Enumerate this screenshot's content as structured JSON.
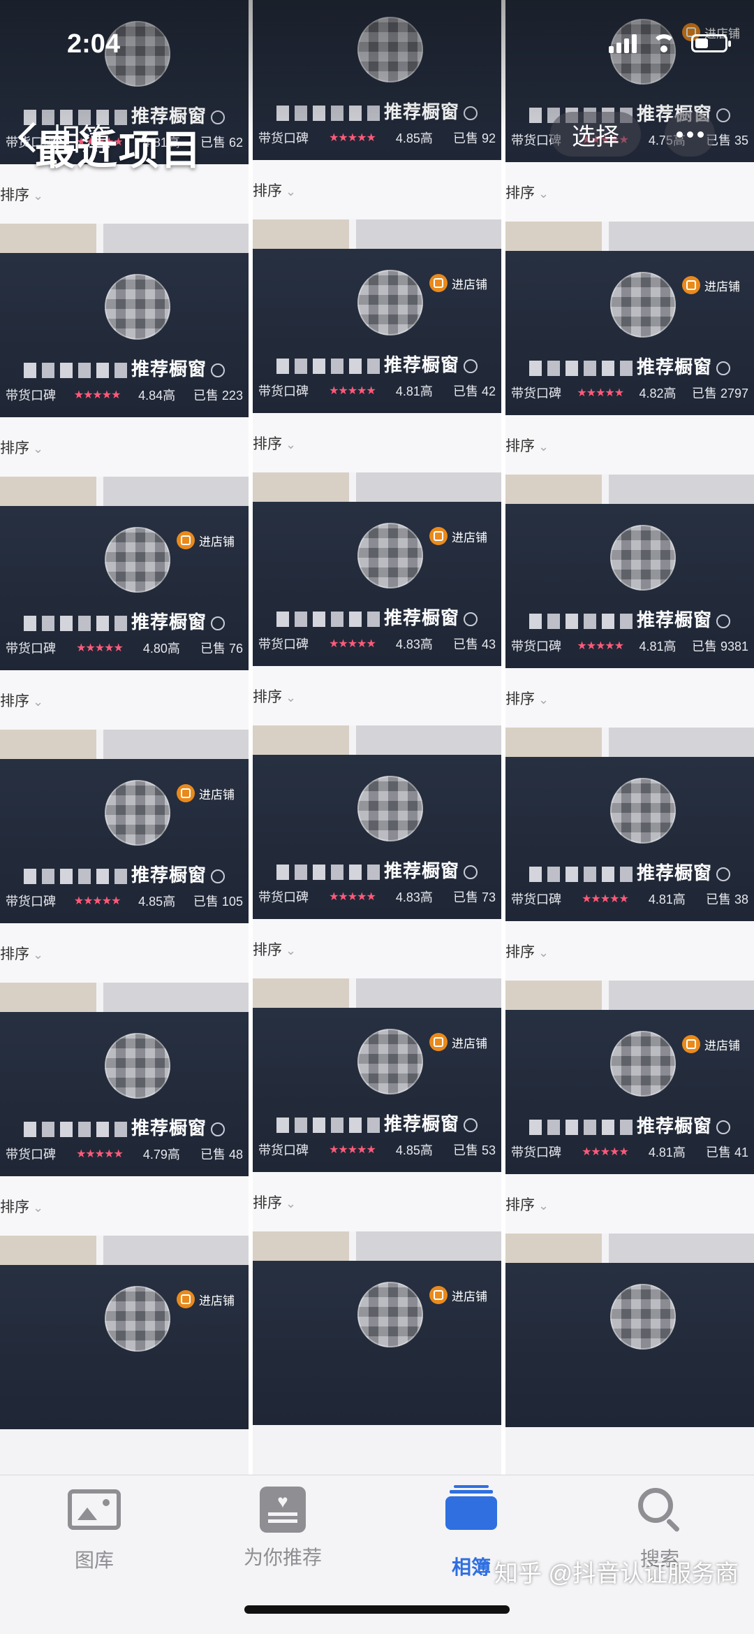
{
  "status_bar": {
    "time": "2:04"
  },
  "nav": {
    "back_label": "相簿",
    "select_label": "选择",
    "album_title": "最近项目"
  },
  "tile_labels": {
    "sort": "排序",
    "shop_badge": "进店铺",
    "title_suffix": "推荐橱窗",
    "rating_prefix": "带货口碑",
    "stars": "★★★★★"
  },
  "tiles": [
    {
      "score": "4.81高",
      "sold": "已售 62",
      "badge": false
    },
    {
      "score": "4.85高",
      "sold": "已售 92",
      "badge": false
    },
    {
      "score": "4.75高",
      "sold": "已售 35",
      "badge": true
    },
    {
      "score": "4.84高",
      "sold": "已售 223",
      "badge": false
    },
    {
      "score": "4.81高",
      "sold": "已售 42",
      "badge": true
    },
    {
      "score": "4.82高",
      "sold": "已售 2797",
      "badge": true
    },
    {
      "score": "4.80高",
      "sold": "已售 76",
      "badge": true
    },
    {
      "score": "4.83高",
      "sold": "已售 43",
      "badge": true
    },
    {
      "score": "4.81高",
      "sold": "已售 9381",
      "badge": false
    },
    {
      "score": "4.85高",
      "sold": "已售 105",
      "badge": true
    },
    {
      "score": "4.83高",
      "sold": "已售 73",
      "badge": false
    },
    {
      "score": "4.81高",
      "sold": "已售 38",
      "badge": false
    },
    {
      "score": "4.79高",
      "sold": "已售 48",
      "badge": false
    },
    {
      "score": "4.85高",
      "sold": "已售 53",
      "badge": true
    },
    {
      "score": "4.81高",
      "sold": "已售 41",
      "badge": true
    },
    {
      "score": "",
      "sold": "",
      "badge": true
    },
    {
      "score": "",
      "sold": "",
      "badge": true
    },
    {
      "score": "",
      "sold": "",
      "badge": false
    }
  ],
  "tabbar": {
    "items": [
      {
        "label": "图库",
        "icon": "photo-library-icon",
        "active": false
      },
      {
        "label": "为你推荐",
        "icon": "for-you-icon",
        "active": false
      },
      {
        "label": "相簿",
        "icon": "albums-icon",
        "active": true
      },
      {
        "label": "搜索",
        "icon": "search-icon",
        "active": false
      }
    ]
  },
  "watermark": "知乎 @抖音认证服务商",
  "colors": {
    "accent": "#2f6fe0",
    "card_bg": "#232b3a",
    "star": "#ff5a7a",
    "badge": "#e98a1c"
  }
}
